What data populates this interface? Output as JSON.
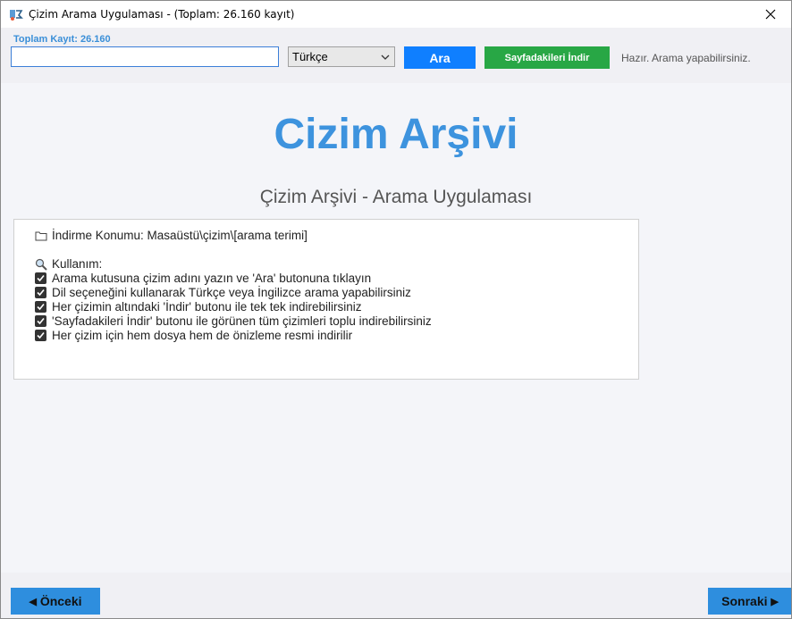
{
  "window": {
    "title": "Çizim Arama Uygulaması - (Toplam: 26.160 kayıt)"
  },
  "toolbar": {
    "total_label": "Toplam Kayıt: 26.160",
    "search_value": "",
    "language_selected": "Türkçe",
    "search_button": "Ara",
    "download_page_button": "Sayfadakileri İndir",
    "status": "Hazır. Arama yapabilirsiniz."
  },
  "main": {
    "title": "Cizim Arşivi",
    "subtitle": "Çizim Arşivi - Arama Uygulaması",
    "download_location": "İndirme Konumu: Masaüstü\\çizim\\[arama terimi]",
    "usage_heading": "Kullanım:",
    "usage_items": [
      "Arama kutusuna çizim adını yazın ve 'Ara' butonuna tıklayın",
      "Dil seçeneğini kullanarak Türkçe veya İngilizce arama yapabilirsiniz",
      "Her çizimin altındaki 'İndir' butonu ile tek tek indirebilirsiniz",
      "'Sayfadakileri İndir' butonu ile görünen tüm çizimleri toplu indirebilirsiniz",
      "Her çizim için hem dosya hem de önizleme resmi indirilir"
    ]
  },
  "nav": {
    "prev_button": "Önceki",
    "next_button": "Sonraki"
  },
  "colors": {
    "accent_blue": "#3d93de",
    "search_button": "#0f7fff",
    "download_button": "#28a745",
    "nav_button": "#2e8ede"
  },
  "icons": {
    "app": "app-icon",
    "close": "close-icon",
    "folder": "folder-icon",
    "search": "magnifier-icon",
    "check": "checkbox-checked-icon"
  }
}
